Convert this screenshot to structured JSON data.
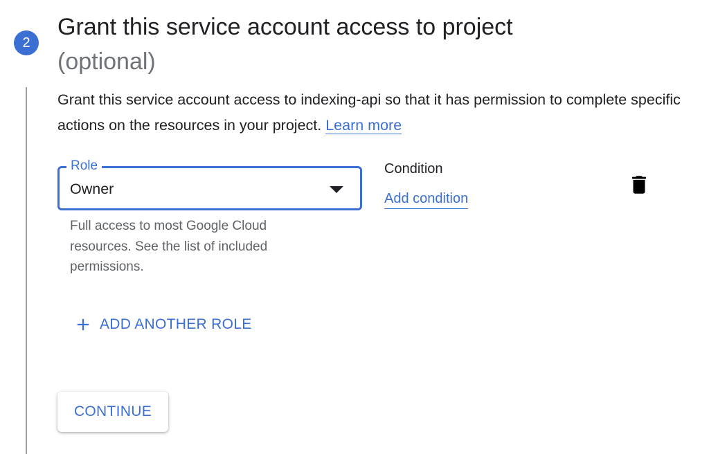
{
  "step": {
    "number": "2",
    "title": "Grant this service account access to project",
    "optional_label": "(optional)"
  },
  "description": {
    "text": "Grant this service account access to indexing-api so that it has permission to complete specific actions on the resources in your project.",
    "learn_more": "Learn more"
  },
  "role_field": {
    "label": "Role",
    "value": "Owner",
    "helper": "Full access to most Google Cloud resources. See the list of included permissions."
  },
  "condition": {
    "title": "Condition",
    "add_link": "Add condition"
  },
  "actions": {
    "add_role": "ADD ANOTHER ROLE",
    "continue": "CONTINUE"
  },
  "icons": {
    "dropdown": "chevron-down-icon",
    "delete": "trash-icon",
    "add": "plus-icon"
  },
  "colors": {
    "accent": "#3b6fd4",
    "text": "#202124",
    "secondary_text": "#5f6368",
    "optional_text": "#6f7377"
  }
}
